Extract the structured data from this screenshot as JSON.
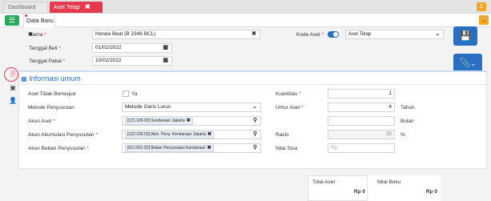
{
  "tabs": {
    "dashboard": "Dashboard",
    "active": "Aset Tetap",
    "close": "✖"
  },
  "badge": {
    "count": "2"
  },
  "toolbar": {
    "menu_icon": "☰",
    "doc_tab": "Data Baru",
    "doc_close": "✖"
  },
  "lock_icon": "🔒",
  "form": {
    "nama": {
      "label": "Nama",
      "value": "Honda Beat (B 2346 BCL)",
      "clear": "✖"
    },
    "kode": {
      "label": "Kode Aset",
      "value": "Aset Tetap"
    },
    "tanggal_beli": {
      "label": "Tanggal Beli",
      "value": "01/02/2022"
    },
    "tanggal_pakai": {
      "label": "Tanggal Pakai",
      "value": "10/02/2022"
    },
    "required_mark": "*"
  },
  "buttons": {
    "save_icon": "💾",
    "attach_icon": "📎",
    "attach_caret": "⌄"
  },
  "section": {
    "title": "Informasi umum"
  },
  "general": {
    "aset_tidak_berwujud": {
      "label": "Aset Tidak Berwujud",
      "checkbox_label": "Ya"
    },
    "metode": {
      "label": "Metode Penyusutan",
      "value": "Metode Garis Lurus"
    },
    "akun_aset": {
      "label": "Akun Aset",
      "value": "[121.100-03] Kendaraan Jakarta"
    },
    "akun_akumulasi": {
      "label": "Akun Akumulasi Penyusutan",
      "value": "[122.100-02] Akm. Peny. Kendaraan Jakarta"
    },
    "akun_beban": {
      "label": "Akun Beban Penyusutan",
      "value": "[612.001-02] Beban Penyusutan Kendaraan"
    },
    "kuantitas": {
      "label": "Kuantitas",
      "value": "1"
    },
    "umur": {
      "label": "Umur Aset",
      "value": "4",
      "unit1": "Tahun",
      "unit2": "Bulan"
    },
    "rasio": {
      "label": "Rasio",
      "value": "25",
      "unit": "%"
    },
    "nilai_sisa": {
      "label": "Nilai Sisa",
      "placeholder": "Rp"
    }
  },
  "summary": {
    "total_label": "Total Aset",
    "total_value": "Rp 0",
    "book_label": "Nilai Buku",
    "book_value": "Rp 0"
  }
}
